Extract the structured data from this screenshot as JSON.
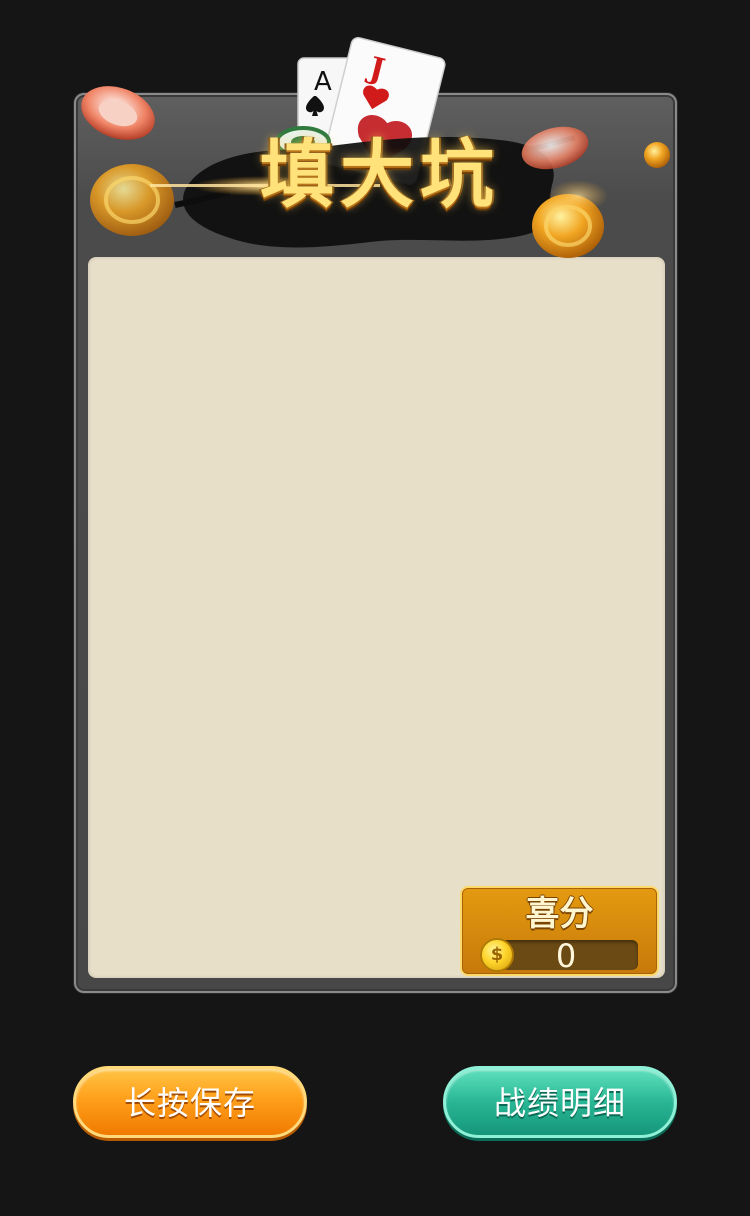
{
  "header": {
    "title": "填大坑",
    "card_a_rank": "A",
    "card_j_rank": "J"
  },
  "score": {
    "label": "喜分",
    "value": "0",
    "coin_symbol": "$"
  },
  "buttons": {
    "save_label": "长按保存",
    "record_label": "战绩明细"
  },
  "colors": {
    "background": "#151515",
    "panel": "#4b4b4b",
    "content": "#e8dfc9",
    "score_box": "#d98a0c",
    "save_button": "#ffa01b",
    "record_button": "#29b795"
  }
}
